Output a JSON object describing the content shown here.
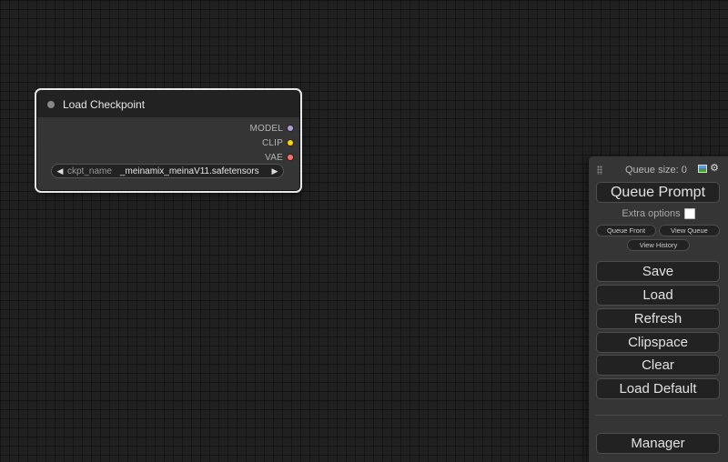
{
  "node": {
    "title": "Load Checkpoint",
    "outputs": [
      {
        "label": "MODEL",
        "color": "#b39ddb"
      },
      {
        "label": "CLIP",
        "color": "#ffd500"
      },
      {
        "label": "VAE",
        "color": "#ff6e6e"
      }
    ],
    "widget": {
      "name": "ckpt_name",
      "value": "_meinamix_meinaV11.safetensors",
      "left_arrow": "◀",
      "right_arrow": "▶"
    }
  },
  "menu": {
    "queue_size_label": "Queue size: 0",
    "queue_prompt": "Queue Prompt",
    "extra_options": "Extra options",
    "extra_options_checked": false,
    "queue_front": "Queue Front",
    "view_queue": "View Queue",
    "view_history": "View History",
    "buttons": {
      "save": "Save",
      "load": "Load",
      "refresh": "Refresh",
      "clipspace": "Clipspace",
      "clear": "Clear",
      "load_default": "Load Default",
      "manager": "Manager"
    },
    "icons": {
      "image": "image-icon",
      "settings": "gear-icon",
      "settings_glyph": "⚙"
    }
  },
  "colors": {
    "canvas_bg": "#202020",
    "node_bg": "#353535",
    "node_header_bg": "#222222",
    "menu_bg": "#353535",
    "button_bg": "#222222",
    "selection_outline": "#e8e8e8"
  }
}
